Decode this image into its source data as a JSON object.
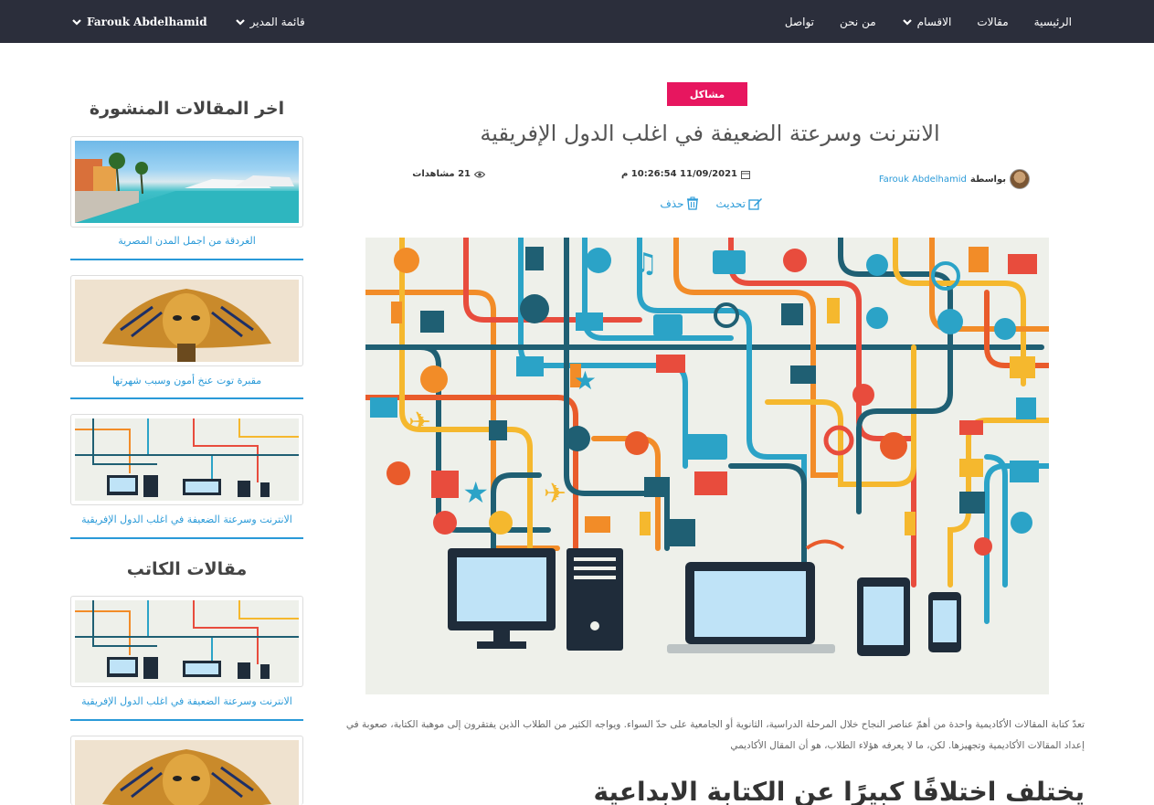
{
  "nav": {
    "right_items": [
      {
        "label": "الرئيسية",
        "dropdown": false
      },
      {
        "label": "مقالات",
        "dropdown": false
      },
      {
        "label": "الاقسام",
        "dropdown": true
      },
      {
        "label": "من نحن",
        "dropdown": false
      },
      {
        "label": "تواصل",
        "dropdown": false
      }
    ],
    "admin_menu": "قائمة المدير",
    "user_name": "Farouk Abdelhamid"
  },
  "article": {
    "category": "مشاكل",
    "title": "الانترنت وسرعتة الضعيفة في اغلب الدول الإفريقية",
    "by_label": "بواسطة",
    "author": "Farouk Abdelhamid",
    "datetime": "11/09/2021 10:26:54 م",
    "views": "21 مشاهدات",
    "edit_label": "تحديث",
    "delete_label": "حذف",
    "paragraph": "تعدّ كتابة المقالات الأكاديمية واحدة من أهمّ عناصر النجاح خلال المرحلة الدراسية، الثانوية أو الجامعية على حدّ السواء. ويواجه الكثير من الطلاب الذين يفتقرون إلى موهبة الكتابة، صعوبة في إعداد المقالات الأكاديمية وتجهيزها. لكن، ما لا يعرفه هؤلاء الطلاب، هو أن المقال الأكاديمي",
    "heading2": "يختلف اختلافًا كبيرًا عن الكتابة الابداعية"
  },
  "sidebar": {
    "latest_title": "اخر المقالات المنشورة",
    "latest": [
      {
        "caption": "الغردقة من اجمل المدن المصرية",
        "thumb": "hurghada"
      },
      {
        "caption": "مقبرة توت عنخ أمون وسبب شهرتها",
        "thumb": "tutankhamun"
      },
      {
        "caption": "الانترنت وسرعتة الضعيفة في اغلب الدول الإفريقية",
        "thumb": "network"
      }
    ],
    "author_title": "مقالات الكاتب",
    "author_posts": [
      {
        "caption": "الانترنت وسرعتة الضعيفة في اغلب الدول الإفريقية",
        "thumb": "network"
      },
      {
        "caption": "",
        "thumb": "tutankhamun"
      }
    ]
  },
  "colors": {
    "navbar": "#2b2e3b",
    "badge": "#e7165f",
    "link": "#2a9ad8"
  }
}
